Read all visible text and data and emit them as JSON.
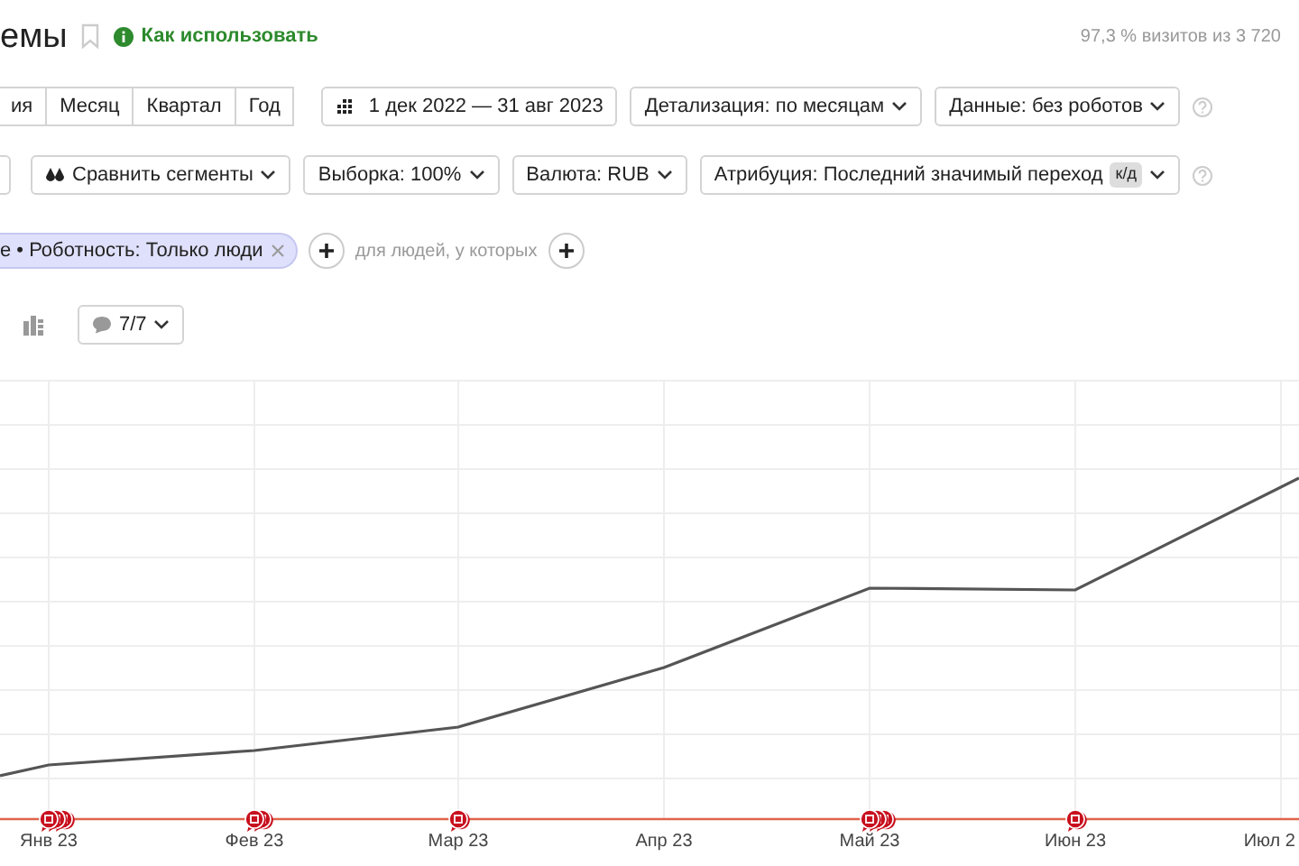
{
  "title": "емы",
  "bookmarked": false,
  "help_link": "Как использовать",
  "sampling_note": "97,3 % визитов из 3 720",
  "periods": [
    {
      "label": "ия",
      "selected": false
    },
    {
      "label": "Месяц",
      "selected": false
    },
    {
      "label": "Квартал",
      "selected": false
    },
    {
      "label": "Год",
      "selected": false
    }
  ],
  "date_range": "1 дек 2022 — 31 авг 2023",
  "toolbar_1": [
    {
      "label": "Детализация: по месяцам"
    },
    {
      "label": "Данные: без роботов"
    }
  ],
  "toolbar_2": [
    {
      "kind": "cut"
    },
    {
      "kind": "compare",
      "label": "Сравнить сегменты"
    },
    {
      "kind": "dropdown",
      "label": "Выборка: 100%"
    },
    {
      "kind": "dropdown",
      "label": "Валюта: RUB"
    },
    {
      "kind": "dropdown",
      "label": "Атрибуция: Последний значимый переход",
      "tag": "к/д"
    }
  ],
  "segment_chip": "е • Роботность: Только люди",
  "add_hint": "для людей, у которых",
  "notes_filter": "7/7",
  "chart": {
    "x_labels": [
      {
        "label": "Янв 23",
        "notes": [
          {
            "kind": "note"
          },
          {
            "kind": "note"
          },
          {
            "kind": "note"
          }
        ]
      },
      {
        "label": "Фев 23",
        "notes": [
          {
            "kind": "note"
          },
          {
            "kind": "note"
          }
        ]
      },
      {
        "label": "Мар 23",
        "notes": [
          {
            "kind": "note"
          }
        ]
      },
      {
        "label": "Апр 23"
      },
      {
        "label": "Май 23",
        "notes": [
          {
            "kind": "note"
          },
          {
            "kind": "note"
          },
          {
            "kind": "note"
          }
        ]
      },
      {
        "label": "Июн 23",
        "notes": [
          {
            "kind": "note"
          }
        ]
      },
      {
        "label": "Июл 2"
      }
    ]
  }
}
